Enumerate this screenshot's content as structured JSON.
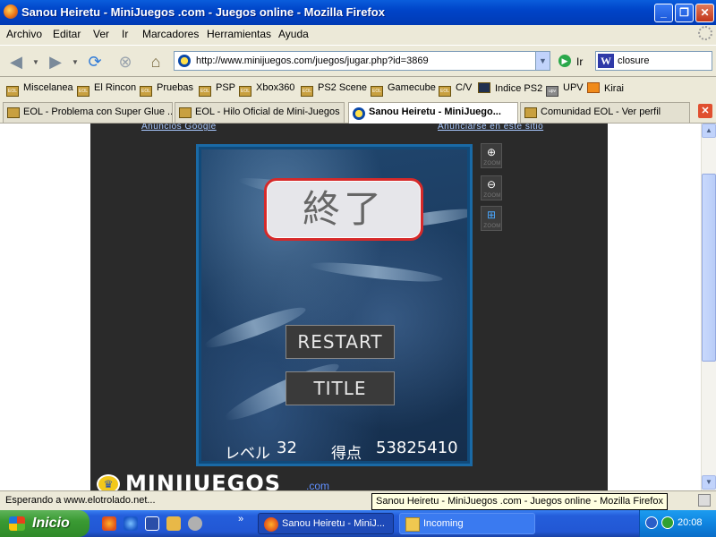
{
  "window": {
    "title": "Sanou Heiretu - MiniJuegos .com - Juegos online - Mozilla Firefox",
    "buttons": {
      "minimize": "_",
      "maximize": "❐",
      "close": "✕"
    }
  },
  "menu": [
    "Archivo",
    "Editar",
    "Ver",
    "Ir",
    "Marcadores",
    "Herramientas",
    "Ayuda"
  ],
  "nav": {
    "url": "http://www.minijuegos.com/juegos/jugar.php?id=3869",
    "go_label": "Ir",
    "search_value": "closure",
    "search_engine_icon": "W"
  },
  "bookmarks": [
    "Miscelanea",
    "El Rincon",
    "Pruebas",
    "PSP",
    "Xbox360",
    "PS2 Scene",
    "Gamecube",
    "C/V",
    "Indice PS2",
    "UPV",
    "Kirai"
  ],
  "tabs": [
    {
      "label": "EOL - Problema con Super Glue ..."
    },
    {
      "label": "EOL - Hilo Oficial de Mini-Juegos"
    },
    {
      "label": "Sanou Heiretu - MiniJuego..."
    },
    {
      "label": "Comunidad EOL - Ver perfil"
    }
  ],
  "page": {
    "ads_left": "Anuncios Google",
    "ads_right": "Anunciarse en este sitio",
    "zoom_label": "ZOOM",
    "logo_text": "MINIJUEGOS",
    "logo_suffix": ".com"
  },
  "game": {
    "end_text": "終了",
    "restart_label": "RESTART",
    "title_label": "TITLE",
    "level_label": "レベル",
    "level_value": "32",
    "score_label": "得点",
    "score_value": "53825410"
  },
  "status": {
    "text": "Esperando a www.elotrolado.net...",
    "tooltip": "Sanou Heiretu - MiniJuegos .com - Juegos online - Mozilla Firefox"
  },
  "taskbar": {
    "start_label": "Inicio",
    "tasks": [
      "Sanou Heiretu - MiniJ...",
      "Incoming"
    ],
    "clock": "20:08",
    "more": "»"
  }
}
